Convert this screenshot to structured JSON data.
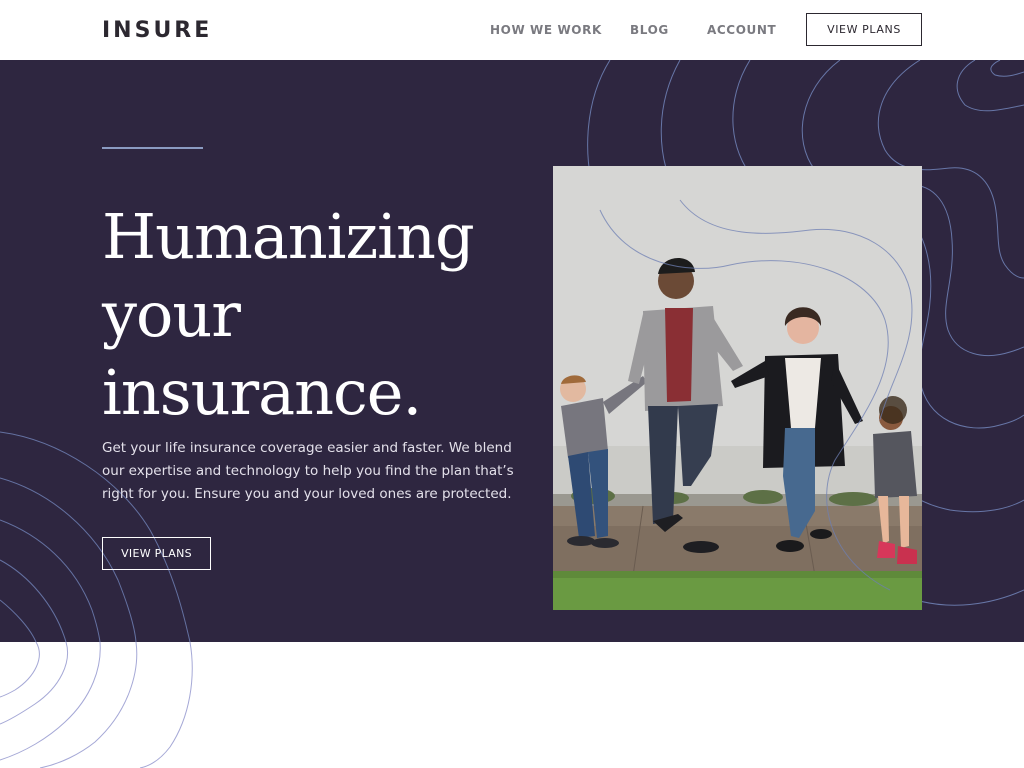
{
  "header": {
    "logo": "INSURE",
    "nav": [
      {
        "label": "HOW WE WORK"
      },
      {
        "label": "BLOG"
      },
      {
        "label": "ACCOUNT"
      }
    ],
    "cta_label": "VIEW PLANS"
  },
  "hero": {
    "title": "Humanizing your insurance.",
    "description": "Get your life insurance coverage easier and faster. We blend our expertise and technology to help you find the plan that’s right for you. Ensure you and your loved ones are protected.",
    "cta_label": "VIEW PLANS"
  },
  "colors": {
    "hero_background": "#2e2640",
    "accent_line": "#8b9bc2",
    "header_background": "#ffffff",
    "nav_text": "#7a7a80",
    "dark_text": "#2c2830"
  }
}
